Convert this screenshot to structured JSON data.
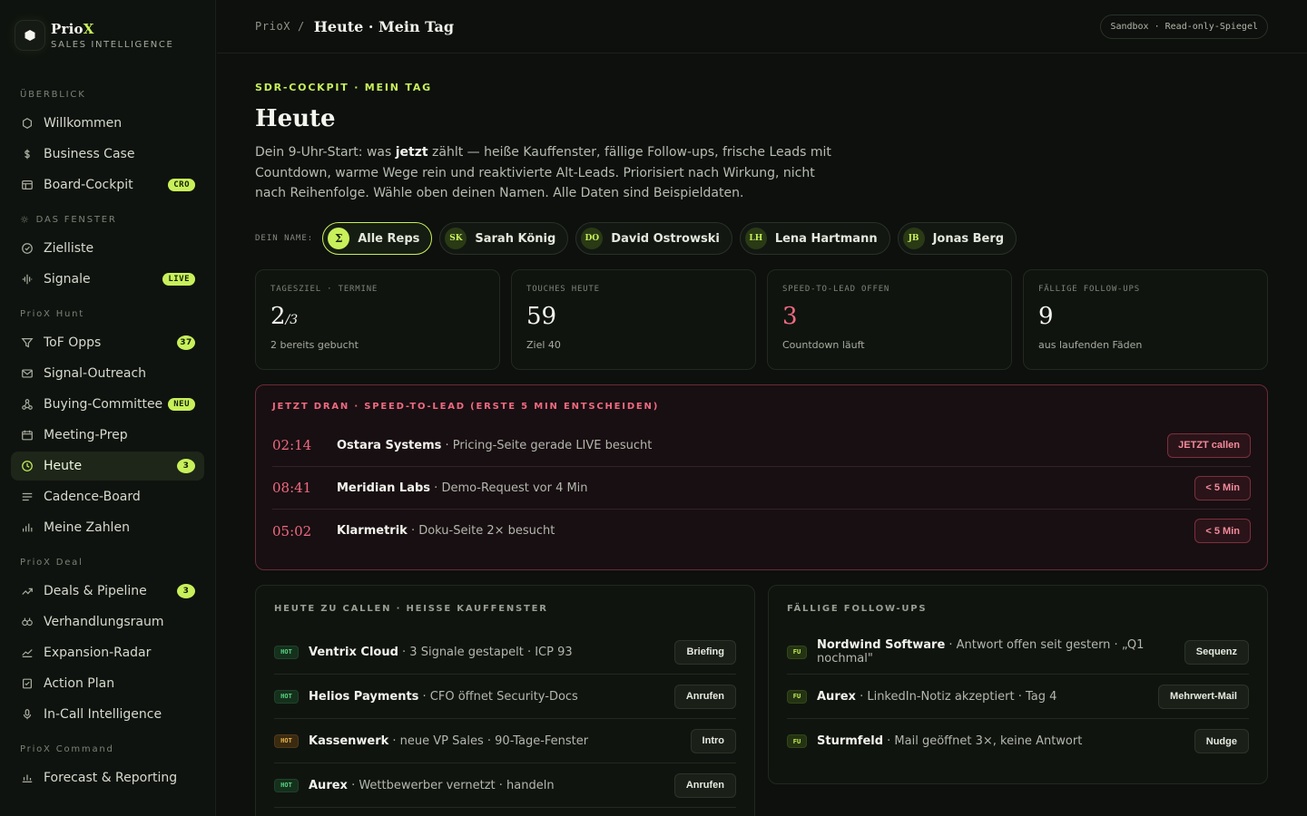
{
  "brand": {
    "name_main": "Prio",
    "name_x": "X",
    "subtitle": "SALES INTELLIGENCE"
  },
  "sidebar": {
    "sections": [
      {
        "title": "ÜBERBLICK",
        "icon": "",
        "items": [
          {
            "label": "Willkommen",
            "icon": "hexagon-icon",
            "badge": ""
          },
          {
            "label": "Business Case",
            "icon": "dollar-icon",
            "badge": ""
          },
          {
            "label": "Board-Cockpit",
            "icon": "board-icon",
            "badge": "CRO"
          }
        ]
      },
      {
        "title": "DAS FENSTER",
        "icon": "sun-icon",
        "items": [
          {
            "label": "Zielliste",
            "icon": "check-circle-icon",
            "badge": ""
          },
          {
            "label": "Signale",
            "icon": "signal-icon",
            "badge": "LIVE"
          }
        ]
      },
      {
        "title": "PrioX Hunt",
        "icon": "",
        "items": [
          {
            "label": "ToF Opps",
            "icon": "filter-icon",
            "badge": "37"
          },
          {
            "label": "Signal-Outreach",
            "icon": "mail-icon",
            "badge": ""
          },
          {
            "label": "Buying-Committee",
            "icon": "nodes-icon",
            "badge": "NEU"
          },
          {
            "label": "Meeting-Prep",
            "icon": "calendar-icon",
            "badge": ""
          },
          {
            "label": "Heute",
            "icon": "clock-icon",
            "badge": "3",
            "active": true
          },
          {
            "label": "Cadence-Board",
            "icon": "lines-icon",
            "badge": ""
          },
          {
            "label": "Meine Zahlen",
            "icon": "bar-chart-icon",
            "badge": ""
          }
        ]
      },
      {
        "title": "PrioX Deal",
        "icon": "",
        "items": [
          {
            "label": "Deals & Pipeline",
            "icon": "trend-icon",
            "badge": "3"
          },
          {
            "label": "Verhandlungsraum",
            "icon": "handshake-icon",
            "badge": ""
          },
          {
            "label": "Expansion-Radar",
            "icon": "area-chart-icon",
            "badge": ""
          },
          {
            "label": "Action Plan",
            "icon": "checklist-icon",
            "badge": ""
          },
          {
            "label": "In-Call Intelligence",
            "icon": "mic-icon",
            "badge": ""
          }
        ]
      },
      {
        "title": "PrioX Command",
        "icon": "",
        "items": [
          {
            "label": "Forecast & Reporting",
            "icon": "chart-icon",
            "badge": ""
          }
        ]
      }
    ]
  },
  "topbar": {
    "crumb_root": "PrioX /",
    "crumb_title": "Heute · Mein Tag",
    "env": "Sandbox · Read-only-Spiegel"
  },
  "main": {
    "eyebrow": "SDR-COCKPIT · MEIN TAG",
    "title": "Heute",
    "intro_1": "Dein 9-Uhr-Start: was ",
    "intro_bold": "jetzt",
    "intro_2": " zählt — heiße Kauffenster, fällige Follow-ups, frische Leads mit Countdown, warme Wege rein und reaktivierte Alt-Leads. Priorisiert nach Wirkung, nicht nach Reihenfolge. Wähle oben deinen Namen. Alle Daten sind Beispieldaten.",
    "reps_label": "DEIN NAME:",
    "reps": [
      {
        "initials": "Σ",
        "name": "Alle Reps",
        "active": true
      },
      {
        "initials": "SK",
        "name": "Sarah König"
      },
      {
        "initials": "DO",
        "name": "David Ostrowski"
      },
      {
        "initials": "LH",
        "name": "Lena Hartmann"
      },
      {
        "initials": "JB",
        "name": "Jonas Berg"
      }
    ],
    "kpis": [
      {
        "label": "TAGESZIEL · TERMINE",
        "value": "2",
        "value_small": "/3",
        "sub": "2 bereits gebucht"
      },
      {
        "label": "TOUCHES HEUTE",
        "value": "59",
        "value_small": "",
        "sub": "Ziel 40"
      },
      {
        "label": "SPEED-TO-LEAD OFFEN",
        "value": "3",
        "value_small": "",
        "sub": "Countdown läuft",
        "red": true
      },
      {
        "label": "FÄLLIGE FOLLOW-UPS",
        "value": "9",
        "value_small": "",
        "sub": "aus laufenden Fäden"
      }
    ],
    "speed": {
      "title": "JETZT DRAN · SPEED-TO-LEAD (ERSTE 5 MIN ENTSCHEIDEN)",
      "rows": [
        {
          "time": "02:14",
          "company": "Ostara Systems",
          "detail": " · Pricing-Seite gerade LIVE besucht",
          "action": "JETZT callen"
        },
        {
          "time": "08:41",
          "company": "Meridian Labs",
          "detail": " · Demo-Request vor 4 Min",
          "action": "< 5 Min"
        },
        {
          "time": "05:02",
          "company": "Klarmetrik",
          "detail": " · Doku-Seite 2× besucht",
          "action": "< 5 Min"
        }
      ]
    },
    "calls": {
      "title": "HEUTE ZU CALLEN · HEISSE KAUFFENSTER",
      "rows": [
        {
          "tag": "HOT",
          "tone": "green",
          "company": "Ventrix Cloud",
          "detail": " · 3 Signale gestapelt · ICP 93",
          "action": "Briefing"
        },
        {
          "tag": "HOT",
          "tone": "green",
          "company": "Helios Payments",
          "detail": " · CFO öffnet Security-Docs",
          "action": "Anrufen"
        },
        {
          "tag": "HOT",
          "tone": "amber",
          "company": "Kassenwerk",
          "detail": " · neue VP Sales · 90-Tage-Fenster",
          "action": "Intro"
        },
        {
          "tag": "HOT",
          "tone": "green",
          "company": "Aurex",
          "detail": " · Wettbewerber vernetzt · handeln",
          "action": "Anrufen"
        }
      ]
    },
    "followups": {
      "title": "FÄLLIGE FOLLOW-UPS",
      "rows": [
        {
          "tag": "FU",
          "company": "Nordwind Software",
          "detail": " · Antwort offen seit gestern · „Q1 nochmal\"",
          "action": "Sequenz"
        },
        {
          "tag": "FU",
          "company": "Aurex",
          "detail": " · LinkedIn-Notiz akzeptiert · Tag 4",
          "action": "Mehrwert-Mail"
        },
        {
          "tag": "FU",
          "company": "Sturmfeld",
          "detail": " · Mail geöffnet 3×, keine Antwort",
          "action": "Nudge"
        }
      ]
    }
  }
}
